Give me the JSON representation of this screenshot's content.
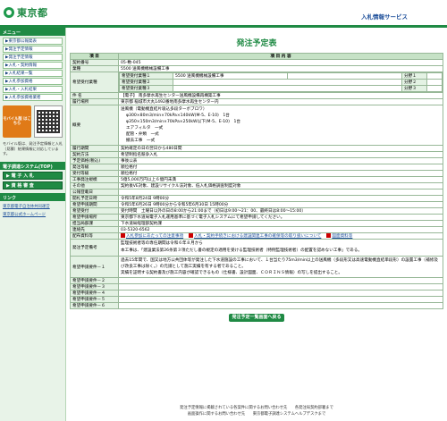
{
  "header": {
    "logo_text": "東京都",
    "service_name": "入札情報サービス"
  },
  "sidebar": {
    "menu_title": "メニュー",
    "items": [
      "▶東京都公報発表",
      "▶発注予定情報",
      "▶発注予定情報",
      "▶入札・契約情報",
      "▶入札結果一覧",
      "▶入札参加資格",
      "▶入札・入札結果",
      "▶入札参加資格業者"
    ],
    "mobile_banner": "モバイル版 はこちら",
    "note": "モバイル版は、発注予定情報と入札（見積）結果情報に対応しています。",
    "section2_title": "電子調達システム(TOP)",
    "buttons": [
      "▶ 電 子 入 札",
      "▶ 資 格 審 査"
    ],
    "section3_title": "リンク",
    "links": [
      "東京都電子自治体共同運営",
      "東京都公式ホームページ"
    ]
  },
  "main": {
    "title": "発注予定表",
    "table_header_item": "項 目",
    "table_header_content": "項 目 内 容",
    "rows": [
      {
        "label": "契約番号",
        "value": "05-敷-045"
      },
      {
        "label": "業種",
        "value": "5500 送風機機械設備工事"
      }
    ],
    "required_trades_label": "希望受付業種",
    "required_trades": [
      {
        "name": "希望受付業種１",
        "code": "5500 送風機機械設備工事",
        "bunya": "分野１"
      },
      {
        "name": "希望受付業種２",
        "code": "",
        "bunya": "分野２"
      },
      {
        "name": "希望受付業種３",
        "code": "",
        "bunya": "分野３"
      }
    ],
    "rows2": [
      {
        "label": "件 名",
        "value": "【電子】 南多摩水再生センター送風機設備再構築工事"
      },
      {
        "label": "履行場所",
        "value": "東京都 稲城市大丸1492番地南多摩水再生センター内"
      },
      {
        "label": "概要",
        "lines": [
          "送風機（電動機直結片吸込多段ターボブロワ）",
          "φ300×80m3/min×70kPa×140kW(M-5、E-10)　1台",
          "φ350×150m3/min×70kPa×250kW以下(M-5、E-10)　1台",
          "エアフィルタ　一式",
          "配管・弁類　一式",
          "撤去工事　一式"
        ]
      },
      {
        "label": "履行期間",
        "value": "契約確定の日の翌日から480日間"
      },
      {
        "label": "契約方法",
        "value": "希望制指名競争入札"
      },
      {
        "label": "予定価格(税込)",
        "value": "事後公表"
      },
      {
        "label": "発注等級",
        "value": "順位格付"
      },
      {
        "label": "受付等級",
        "value": "順位格付"
      },
      {
        "label": "工事発注規模",
        "value": "5億5,000万円以上６億円未満"
      },
      {
        "label": "その他",
        "value": "契約後VE対象、建設リサイクル法対象、低入札価格調査制度対象"
      },
      {
        "label": "公報登載日",
        "value": ""
      },
      {
        "label": "開札予定日時",
        "value": "令和5年8月24日 9時00分"
      },
      {
        "label": "希望申請期間",
        "value": "令和5年6月26日 9時00分から令和5年6月30日 15時00分"
      },
      {
        "label": "希望受付",
        "value": "受付時間　土曜日以外の日の8:00から21:00まで（初日は9:00～21：00、最終日は8:00～15:00）"
      },
      {
        "label": "希望申請場所",
        "value": "東京都下水道局電子入札運用基準に基づく電子入札システムにて希望申請してください。"
      },
      {
        "label": "担当局部課",
        "value": "下水道局経理部契約課"
      },
      {
        "label": "連絡先",
        "value": "03-5320-6562"
      }
    ],
    "attachments_label": "配布資料等",
    "attachments": [
      "入札参加にあたっての注意事項",
      "入札・契約手続きにおける建設関連工事の確保等の取り扱いについて",
      "図面資料等"
    ],
    "notes_label": "発注予定備考",
    "notes": [
      "監理技術者等の専任期間は令和６年８月から",
      "本工事は、「建設業法第26条第３項ただし書の規定の適用を受ける監理技術者（特例監理技術者）の配置を認めない工事」である。"
    ],
    "req1_label": "希望申請要件－１",
    "req1": [
      "過去15年間で、国又は地方公共団体等が発注した下水道施設の工事において、１台当たり75m3/min以上の送風機（多段形又は高速電動機直結単段形）の設置工事（補修及び改良工事は除く。）の元請として施工実績を有する者であること。",
      "実績を証明する契約書及び施工内容が確認できるもの（仕様書、設計図面、ＣＯＲＩＮＳ情報）の写しを提出すること。"
    ],
    "req_labels": [
      "希望申請要件－２",
      "希望申請要件－３",
      "希望申請要件－４",
      "希望申請要件－５",
      "希望申請要件－６"
    ],
    "back_button": "発注予定一覧画面へ戻る"
  },
  "footer": {
    "line1": "発注予定情報に掲載されている各案件に関するお問い合わせ先　　各発注局契約部署まで",
    "line2": "画面操作に関するお問い合わせ先　　東京都電子調達システムヘルプデスクまで"
  }
}
